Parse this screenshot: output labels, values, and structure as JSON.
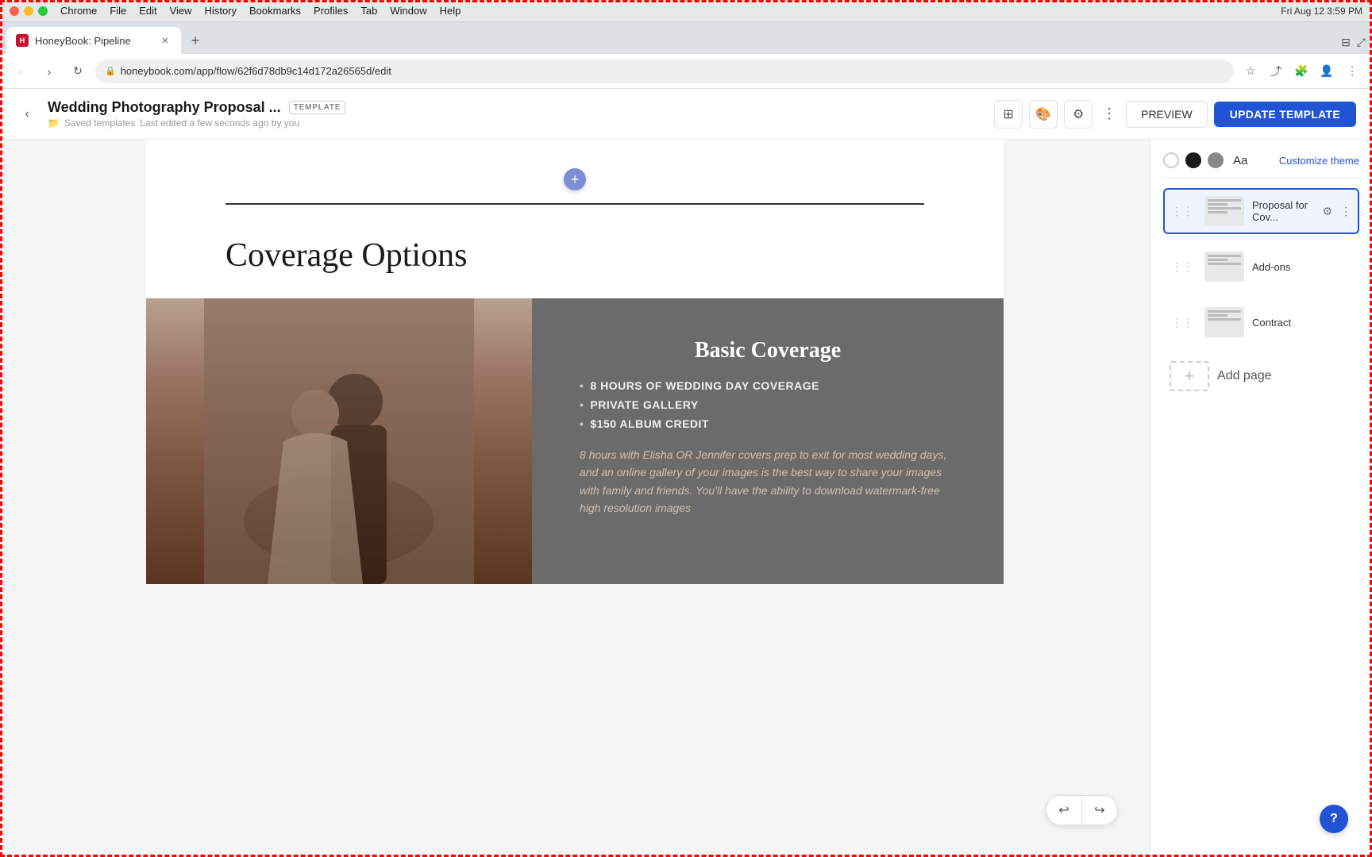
{
  "macbar": {
    "app_name": "Chrome",
    "menu_items": [
      "File",
      "Edit",
      "View",
      "History",
      "Bookmarks",
      "Profiles",
      "Tab",
      "Window",
      "Help"
    ],
    "time": "Fri Aug 12  3:59 PM"
  },
  "tab": {
    "title": "HoneyBook: Pipeline",
    "favicon_text": "H"
  },
  "address": {
    "url": "honeybook.com/app/flow/62f6d78db9c14d172a26565d/edit"
  },
  "header": {
    "title": "Wedding Photography Proposal ...",
    "template_badge": "TEMPLATE",
    "back_label": "‹",
    "subtitle_folder": "Saved templates",
    "subtitle_info": "Last edited a few seconds ago by you",
    "preview_label": "PREVIEW",
    "update_label": "UPDATE TEMPLATE"
  },
  "theme": {
    "customize_label": "Customize theme",
    "font_label": "Aa"
  },
  "sidebar": {
    "pages": [
      {
        "label": "Proposal for Cov...",
        "active": true
      },
      {
        "label": "Add-ons",
        "active": false
      },
      {
        "label": "Contract",
        "active": false
      }
    ],
    "add_page_label": "Add page"
  },
  "canvas": {
    "coverage_heading": "Coverage Options",
    "basic_coverage_title": "Basic Coverage",
    "coverage_items": [
      "8 HOURS OF WEDDING DAY COVERAGE",
      "PRIVATE GALLERY",
      "$150 ALBUM CREDIT"
    ],
    "coverage_desc": "8 hours with Elisha OR Jennifer covers prep to exit for most wedding days, and an online gallery of your images is the best way to share your images with family and friends. You'll have the ability to download watermark-free high resolution images"
  }
}
